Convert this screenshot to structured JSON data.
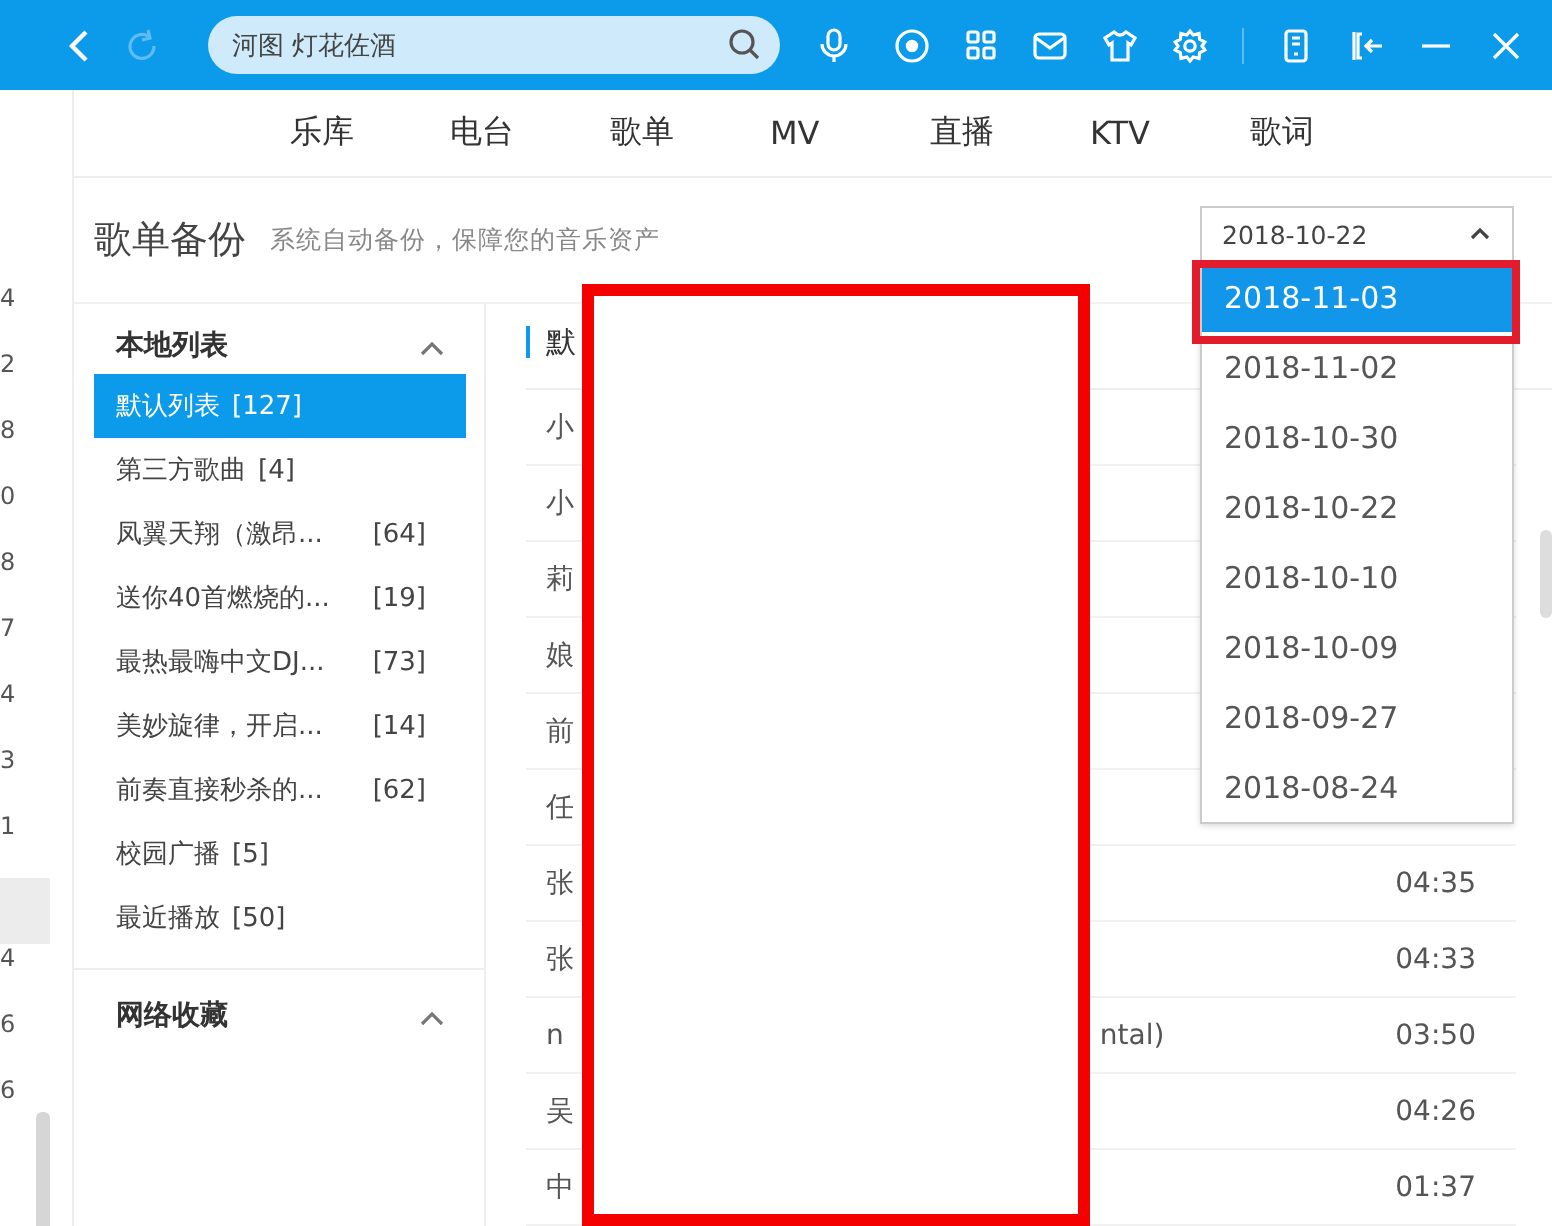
{
  "toolbar": {
    "search": {
      "value": "河图 灯花佐酒"
    }
  },
  "nav_tabs": [
    {
      "label": "乐库",
      "selected": false
    },
    {
      "label": "电台",
      "selected": false
    },
    {
      "label": "歌单",
      "selected": false
    },
    {
      "label": "MV",
      "selected": false
    },
    {
      "label": "直播",
      "selected": false
    },
    {
      "label": "KTV",
      "selected": false
    },
    {
      "label": "歌词",
      "selected": false
    }
  ],
  "left_strip": [
    "4",
    "2",
    "8",
    "0",
    "8",
    "7",
    "4",
    "3",
    "1",
    "4",
    "6",
    "6"
  ],
  "backup": {
    "title": "歌单备份",
    "subtitle": "系统自动备份，保障您的音乐资产",
    "date_select": {
      "value": "2018-10-22",
      "expanded": true,
      "options": [
        {
          "label": "2018-11-03",
          "highlighted": true
        },
        {
          "label": "2018-11-02",
          "highlighted": false
        },
        {
          "label": "2018-10-30",
          "highlighted": false
        },
        {
          "label": "2018-10-22",
          "highlighted": false
        },
        {
          "label": "2018-10-10",
          "highlighted": false
        },
        {
          "label": "2018-10-09",
          "highlighted": false
        },
        {
          "label": "2018-09-27",
          "highlighted": false
        },
        {
          "label": "2018-08-24",
          "highlighted": false
        }
      ]
    }
  },
  "sidebar": {
    "sections": [
      {
        "title": "本地列表",
        "expanded": true,
        "items": [
          {
            "name": "默认列表",
            "count": "[127]",
            "selected": true
          },
          {
            "name": "第三方歌曲",
            "count": "[4]",
            "selected": false
          },
          {
            "name": "凤翼天翔（激昂...",
            "count": "[64]",
            "selected": false
          },
          {
            "name": "送你40首燃烧的...",
            "count": "[19]",
            "selected": false
          },
          {
            "name": "最热最嗨中文DJ...",
            "count": "[73]",
            "selected": false
          },
          {
            "name": "美妙旋律，开启...",
            "count": "[14]",
            "selected": false
          },
          {
            "name": "前奏直接秒杀的...",
            "count": "[62]",
            "selected": false
          },
          {
            "name": "校园广播",
            "count": "[5]",
            "selected": false
          },
          {
            "name": "最近播放",
            "count": "[50]",
            "selected": false
          }
        ]
      },
      {
        "title": "网络收藏",
        "expanded": true
      }
    ]
  },
  "song_list": {
    "header": "默",
    "rows": [
      {
        "title": "小"
      },
      {
        "title": "小"
      },
      {
        "title": "莉"
      },
      {
        "title": "娘"
      },
      {
        "title": "前"
      },
      {
        "title": "任"
      },
      {
        "title": "张",
        "duration": "04:35"
      },
      {
        "title": "张",
        "duration": "04:33"
      },
      {
        "title": "n",
        "title_tail": "ntal)",
        "duration": "03:50"
      },
      {
        "title": "吴",
        "duration": "04:26"
      },
      {
        "title": "中",
        "duration": "01:37"
      }
    ]
  }
}
